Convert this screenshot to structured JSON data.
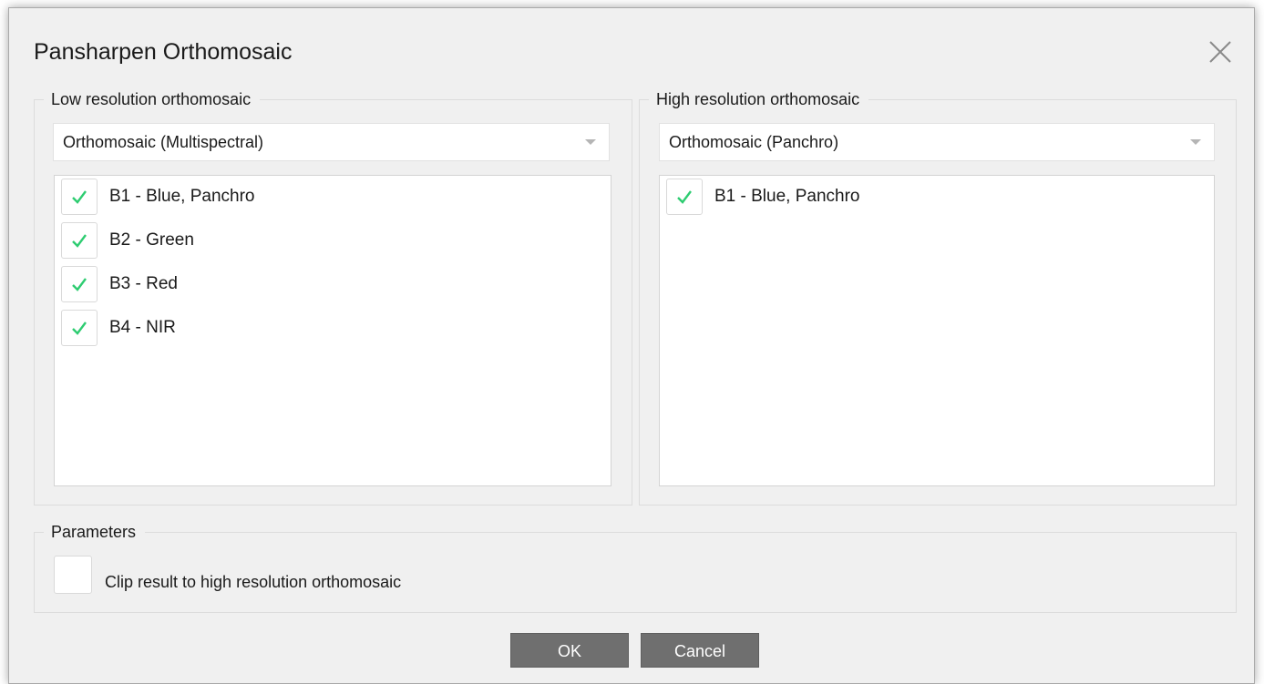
{
  "dialog": {
    "title": "Pansharpen Orthomosaic",
    "close_icon": "close-icon"
  },
  "low_res": {
    "group_label": "Low resolution orthomosaic",
    "selected": "Orthomosaic (Multispectral)",
    "bands": [
      {
        "label": "B1 - Blue, Panchro",
        "checked": true
      },
      {
        "label": "B2 - Green",
        "checked": true
      },
      {
        "label": "B3 - Red",
        "checked": true
      },
      {
        "label": "B4 - NIR",
        "checked": true
      }
    ]
  },
  "high_res": {
    "group_label": "High resolution orthomosaic",
    "selected": "Orthomosaic (Panchro)",
    "bands": [
      {
        "label": "B1 - Blue, Panchro",
        "checked": true
      }
    ]
  },
  "parameters": {
    "group_label": "Parameters",
    "clip_label": "Clip result to high resolution orthomosaic",
    "clip_checked": false
  },
  "buttons": {
    "ok": "OK",
    "cancel": "Cancel"
  },
  "colors": {
    "check": "#2ecc71",
    "button_bg": "#6f6f6f",
    "dialog_bg": "#f0f0f0"
  }
}
